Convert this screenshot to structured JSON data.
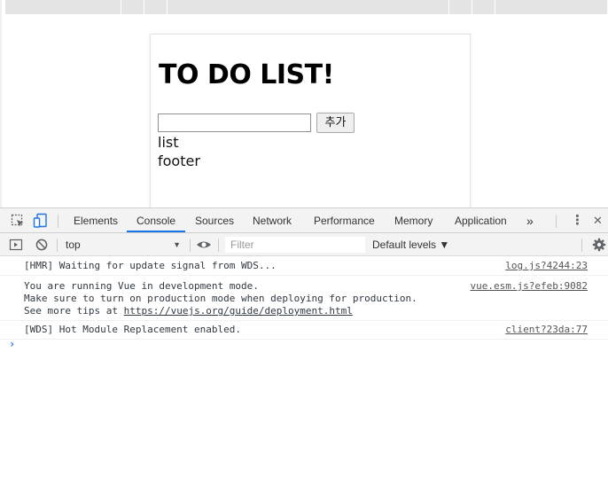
{
  "app": {
    "title": "TO DO LIST!",
    "input_value": "",
    "add_button_label": "추가",
    "list_text": "list",
    "footer_text": "footer"
  },
  "devtools": {
    "tabs": [
      {
        "label": "Elements",
        "active": false
      },
      {
        "label": "Console",
        "active": true
      },
      {
        "label": "Sources",
        "active": false
      },
      {
        "label": "Network",
        "active": false
      },
      {
        "label": "Performance",
        "active": false
      },
      {
        "label": "Memory",
        "active": false
      },
      {
        "label": "Application",
        "active": false
      }
    ],
    "more_tabs_glyph": "»",
    "kebab_glyph": "⋮",
    "close_glyph": "✕",
    "context_value": "top",
    "filter_placeholder": "Filter",
    "levels_label": "Default levels ▼",
    "console_messages": [
      {
        "lines": [
          "[HMR] Waiting for update signal from WDS..."
        ],
        "source": "log.js?4244:23"
      },
      {
        "lines": [
          "You are running Vue in development mode.",
          "Make sure to turn on production mode when deploying for production.",
          "See more tips at "
        ],
        "link": "https://vuejs.org/guide/deployment.html",
        "source": "vue.esm.js?efeb:9082"
      },
      {
        "lines": [
          "[WDS] Hot Module Replacement enabled."
        ],
        "source": "client?23da:77"
      }
    ],
    "prompt_glyph": "›",
    "colors": {
      "accent": "#1a73e8",
      "toolbar_bg": "#f3f3f3",
      "border": "#cfcfcf"
    }
  },
  "icons": [
    "inspect-icon",
    "device-toggle-icon",
    "sidebar-toggle-icon",
    "clear-console-icon",
    "eye-icon",
    "gear-icon"
  ]
}
